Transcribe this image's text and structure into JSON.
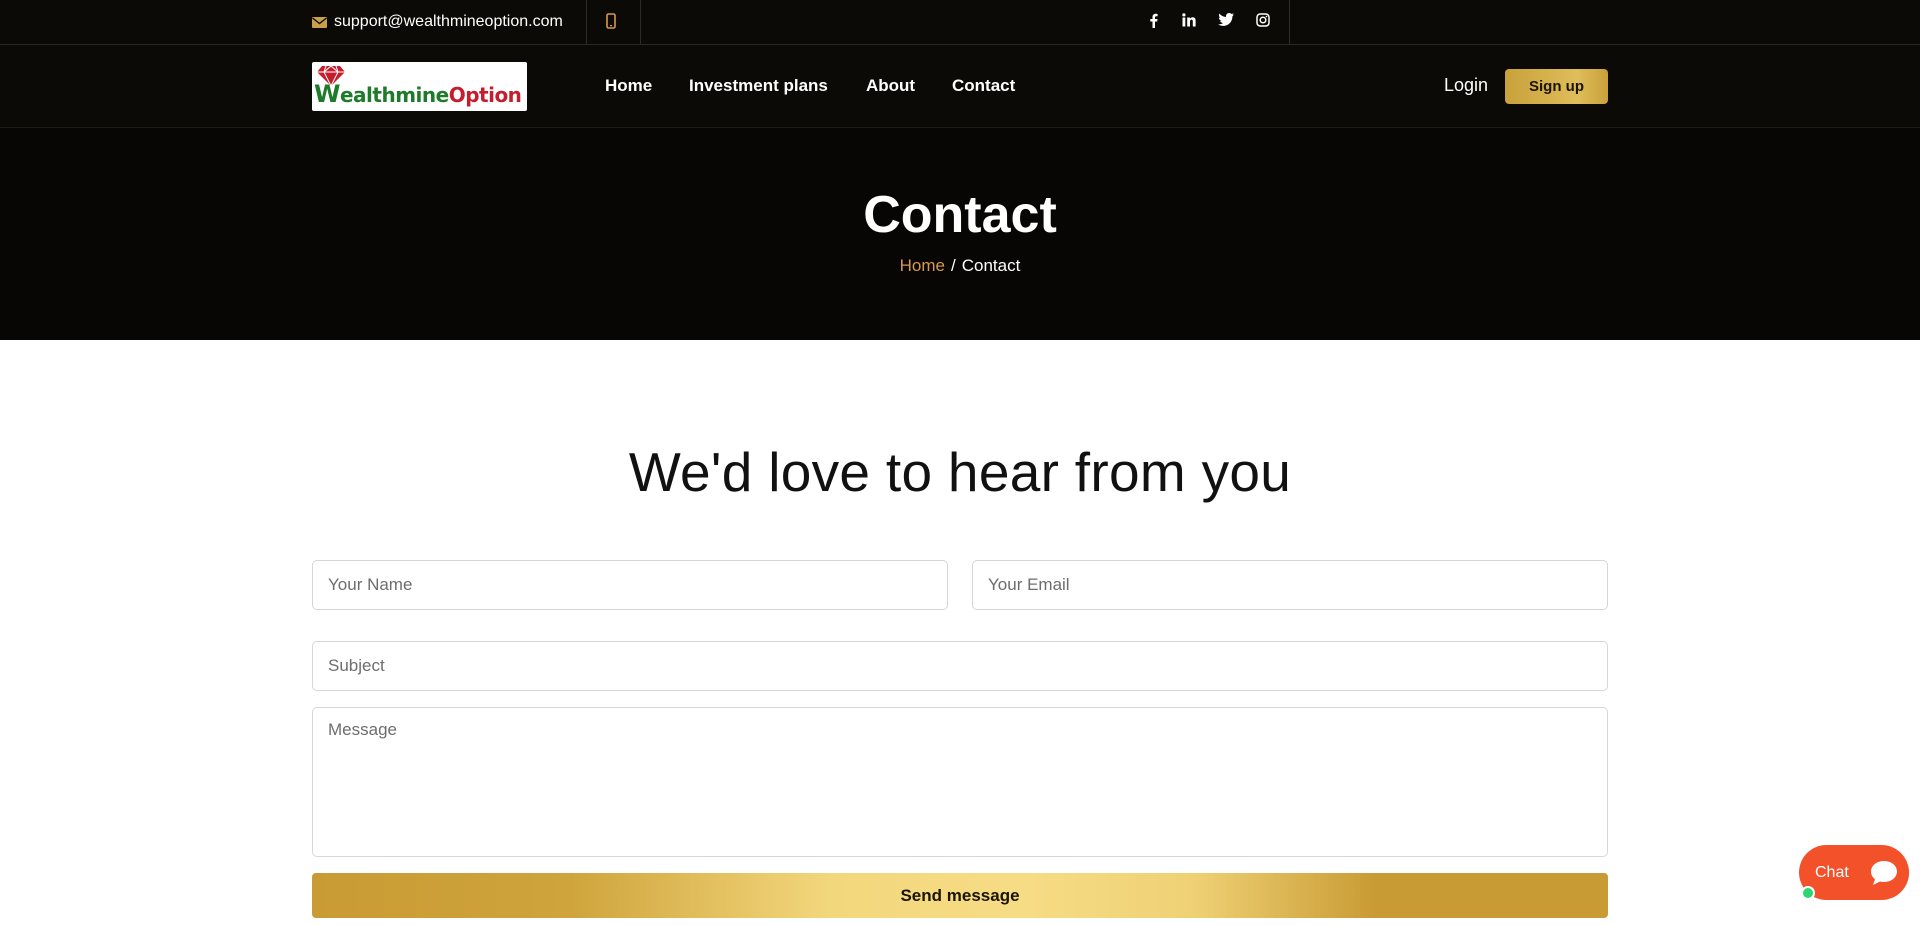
{
  "topbar": {
    "email": "support@wealthmineoption.com",
    "icons": [
      "mail-icon",
      "phone-icon",
      "facebook-icon",
      "linkedin-icon",
      "twitter-icon",
      "instagram-icon"
    ]
  },
  "logo": {
    "part1": "W",
    "part2": "ealthmine",
    "part3": "Option"
  },
  "nav": {
    "items": [
      {
        "label": "Home"
      },
      {
        "label": "Investment plans"
      },
      {
        "label": "About"
      },
      {
        "label": "Contact"
      }
    ],
    "login": "Login",
    "signup": "Sign up"
  },
  "hero": {
    "title": "Contact",
    "breadcrumb": {
      "home": "Home",
      "separator": "/",
      "current": "Contact"
    }
  },
  "form": {
    "heading": "We'd love to hear from you",
    "name_placeholder": "Your Name",
    "email_placeholder": "Your Email",
    "subject_placeholder": "Subject",
    "message_placeholder": "Message",
    "submit": "Send message"
  },
  "chat": {
    "label": "Chat"
  },
  "colors": {
    "accent_gold": "#c99b34",
    "breadcrumb_link": "#d79a4b",
    "chat": "#f2512a",
    "dark_bg": "#0b0a06"
  }
}
